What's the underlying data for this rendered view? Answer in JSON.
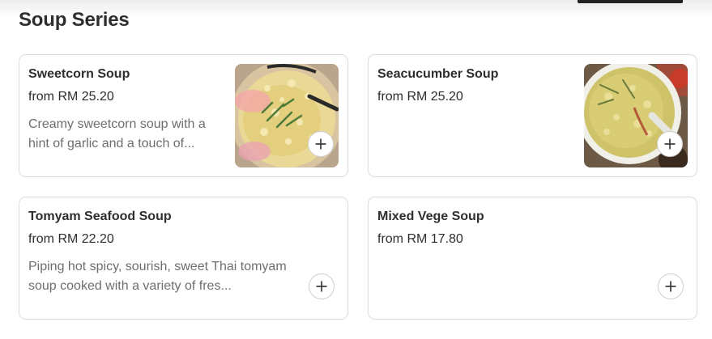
{
  "section": {
    "title": "Soup Series"
  },
  "items": [
    {
      "name": "Sweetcorn Soup",
      "price": "from RM 25.20",
      "description": "Creamy sweetcorn soup with a hint of garlic and a touch of...",
      "image_icon": "sweetcorn-soup-photo",
      "add_icon": "plus-icon"
    },
    {
      "name": "Seacucumber Soup",
      "price": "from RM 25.20",
      "description": "",
      "image_icon": "seacucumber-soup-photo",
      "add_icon": "plus-icon"
    },
    {
      "name": "Tomyam Seafood Soup",
      "price": "from RM 22.20",
      "description": "Piping hot spicy, sourish, sweet Thai tomyam soup cooked with a variety of fres...",
      "add_icon": "plus-icon"
    },
    {
      "name": "Mixed Vege Soup",
      "price": "from RM 17.80",
      "description": "",
      "add_icon": "plus-icon"
    }
  ],
  "colors": {
    "text_primary": "#2e2e2e",
    "text_secondary": "#6e6e6e",
    "card_border": "#dcdcdc",
    "background": "#ffffff"
  }
}
